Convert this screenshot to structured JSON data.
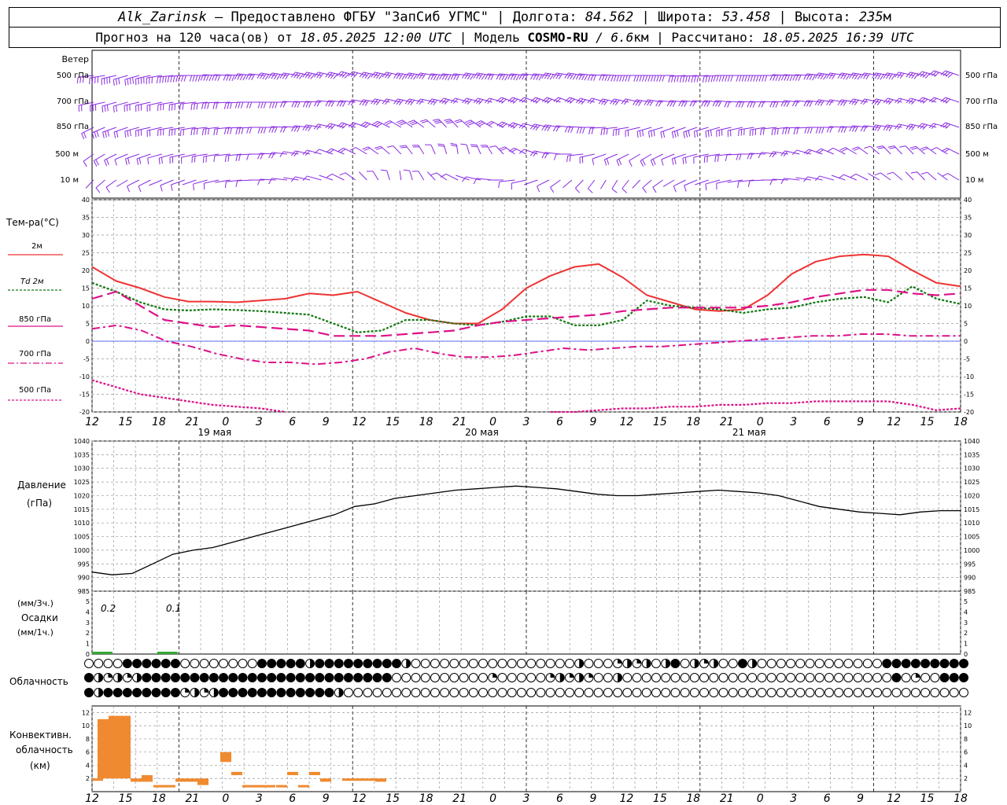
{
  "header": {
    "station": "Alk_Zarinsk",
    "provider": " – Предоставлено ФГБУ \"ЗапСиб УГМС\" | Долгота: ",
    "lon": "84.562",
    "lat_label": " | Широта: ",
    "lat": "53.458",
    "alt_label": " | Высота: ",
    "alt": "235",
    "alt_unit": "м",
    "forecast_prefix": "Прогноз на 120 часа(ов) от ",
    "init_time": "18.05.2025 12:00 UTC",
    "model_label": " | Модель ",
    "model": "COSMO-RU",
    "res": " / 6.6",
    "res_unit": "км",
    "calc_label": " | Рассчитано: ",
    "calc_time": "18.05.2025 16:39 UTC"
  },
  "wind_panel": {
    "title": "Ветер",
    "levels": [
      "500 гПа",
      "700 гПа",
      "850 гПа",
      "500 м",
      "10 м"
    ],
    "color": "#8a2be2"
  },
  "temp_panel": {
    "title": "Тем-ра(°C)",
    "legend": [
      {
        "label": "2м",
        "color": "#ee3333",
        "style": "solid"
      },
      {
        "label": "Td  2м",
        "color": "#117711",
        "style": "dotted"
      },
      {
        "label": "850 гПа",
        "color": "#dd1188",
        "style": "dashed"
      },
      {
        "label": "700 гПа",
        "color": "#dd1188",
        "style": "dashdot"
      },
      {
        "label": "500 гПа",
        "color": "#dd1188",
        "style": "dotted"
      }
    ],
    "yticks": [
      "40",
      "35",
      "30",
      "25",
      "20",
      "15",
      "10",
      "5",
      "0",
      "-5",
      "-10",
      "-15",
      "-20"
    ]
  },
  "pressure_panel": {
    "title": "Давление",
    "unit": "(гПа)",
    "yticks": [
      "1040",
      "1035",
      "1030",
      "1025",
      "1020",
      "1015",
      "1010",
      "1005",
      "1000",
      "995",
      "990",
      "985"
    ]
  },
  "precip_panel": {
    "unit3": "(мм/3ч.)",
    "title": "Осадки",
    "unit1": "(мм/1ч.)",
    "yticks": [
      "5",
      "4",
      "3",
      "2",
      "1",
      "0"
    ],
    "labels": [
      "0.2",
      "0.1"
    ]
  },
  "cloud_panel": {
    "title": "Облачность"
  },
  "conv_panel": {
    "title1": "Конвективн.",
    "title2": "облачность",
    "unit": "(км)",
    "yticks": [
      "12",
      "10",
      "8",
      "6",
      "4",
      "2"
    ]
  },
  "time_axis": {
    "labels": [
      "12",
      "15",
      "18",
      "21",
      "0",
      "3",
      "6",
      "9",
      "12",
      "15",
      "18",
      "21",
      "0",
      "3",
      "6",
      "9",
      "12",
      "15",
      "18",
      "21",
      "0",
      "3",
      "6",
      "9",
      "12",
      "15",
      "18"
    ],
    "days": [
      "19 мая",
      "20 мая",
      "21 мая"
    ]
  },
  "chart_data": [
    {
      "type": "line",
      "title": "Тем-ра(°C)",
      "x_hours": [
        0,
        3,
        6,
        9,
        12,
        15,
        18,
        21,
        24,
        27,
        30,
        33,
        36,
        39,
        42,
        45,
        48,
        51,
        54,
        57,
        60,
        63,
        66,
        69,
        72,
        75,
        78,
        81,
        84,
        87,
        90,
        93,
        96,
        99,
        102,
        105,
        108,
        111,
        114,
        117,
        120
      ],
      "ylim": [
        -20,
        40
      ],
      "series": [
        {
          "name": "2м",
          "values": [
            21,
            17,
            15,
            12.5,
            11.2,
            11.2,
            11,
            11.5,
            12,
            13.5,
            13,
            14,
            11,
            8,
            6,
            5,
            5,
            9,
            15,
            18.5,
            21,
            21.8,
            18,
            13,
            11,
            9,
            8.5,
            9,
            13,
            19,
            22.5,
            24,
            24.5,
            24,
            20,
            16.5,
            15.5
          ]
        },
        {
          "name": "Td  2м",
          "values": [
            16.5,
            14,
            11,
            9,
            8.7,
            9,
            8.8,
            8.5,
            8,
            7.5,
            5,
            2.5,
            3,
            6,
            6,
            5,
            4.5,
            5.5,
            7,
            7,
            4.5,
            4.5,
            6,
            11.5,
            10,
            9.5,
            9,
            8,
            9,
            9.5,
            11,
            12,
            12.5,
            11,
            15.5,
            12,
            10.5
          ]
        },
        {
          "name": "850 гПа",
          "values": [
            12,
            14,
            10,
            6,
            5,
            4,
            4.5,
            4,
            3.5,
            3,
            1.5,
            1.5,
            1.5,
            2,
            2.5,
            3,
            4.5,
            5.5,
            6,
            6.5,
            7,
            7.5,
            8.5,
            9,
            9.5,
            9.5,
            9.5,
            9.5,
            10,
            11,
            12.5,
            13.5,
            14.5,
            14.5,
            13.5,
            13,
            13.5
          ]
        },
        {
          "name": "700 гПа",
          "values": [
            3.5,
            4.5,
            3,
            0,
            -1.5,
            -3.5,
            -5,
            -6,
            -6,
            -6.5,
            -6,
            -5,
            -3,
            -2,
            -3.5,
            -4.5,
            -4.5,
            -4,
            -3,
            -2,
            -2.5,
            -2,
            -1.5,
            -1.5,
            -1,
            -0.5,
            0,
            0.5,
            1,
            1.5,
            1.5,
            2,
            2,
            1.5,
            1.5,
            1.5
          ]
        },
        {
          "name": "500 гПа",
          "values": [
            -11,
            -13,
            -15,
            -16,
            -17,
            -18,
            -18.5,
            -19,
            -20,
            -23,
            -24,
            -25,
            -25,
            -25,
            -24,
            -23,
            -22,
            -21,
            -20.5,
            -20,
            -20,
            -19.5,
            -19,
            -19,
            -18.5,
            -18.5,
            -18,
            -18,
            -17.5,
            -17.5,
            -17,
            -17,
            -17,
            -17,
            -18,
            -19.5,
            -19
          ]
        }
      ]
    },
    {
      "type": "line",
      "title": "Давление",
      "ylim": [
        985,
        1040
      ],
      "series": [
        {
          "name": "Давление",
          "values": [
            992,
            991,
            991.5,
            995,
            998.5,
            1000,
            1001,
            1003,
            1005,
            1007,
            1009,
            1011,
            1013,
            1016,
            1017,
            1019,
            1020,
            1021,
            1022,
            1022.5,
            1023,
            1023.5,
            1023,
            1022.5,
            1021.5,
            1020.5,
            1020,
            1020,
            1020.5,
            1021,
            1021.5,
            1022,
            1021.5,
            1021,
            1020,
            1018,
            1016,
            1015,
            1014,
            1013.5,
            1013,
            1014,
            1014.5,
            1014.5
          ]
        }
      ]
    },
    {
      "type": "bar",
      "title": "Осадки",
      "ylim": [
        0,
        5
      ],
      "series": [
        {
          "name": "Осадки (мм/3ч.)",
          "values": [
            0.2,
            0,
            0,
            0.1
          ]
        }
      ]
    },
    {
      "type": "bar",
      "title": "Конвективн. облачность",
      "ylim": [
        0,
        13
      ],
      "series": [
        {
          "name": "top",
          "values": [
            2,
            11,
            11.5,
            11.5,
            2,
            2.5,
            1,
            1,
            2,
            2,
            2,
            6,
            3,
            1,
            1,
            1,
            1,
            3,
            1,
            3,
            2,
            2,
            2,
            2,
            2
          ]
        },
        {
          "name": "base",
          "values": [
            2,
            2,
            2,
            2,
            1.5,
            1.5,
            1,
            1,
            1.5,
            1.5,
            1,
            4.5,
            2.5,
            1,
            1,
            1,
            1,
            2.5,
            1,
            2.5,
            1.5,
            2,
            2,
            2,
            1.5
          ]
        }
      ]
    }
  ]
}
